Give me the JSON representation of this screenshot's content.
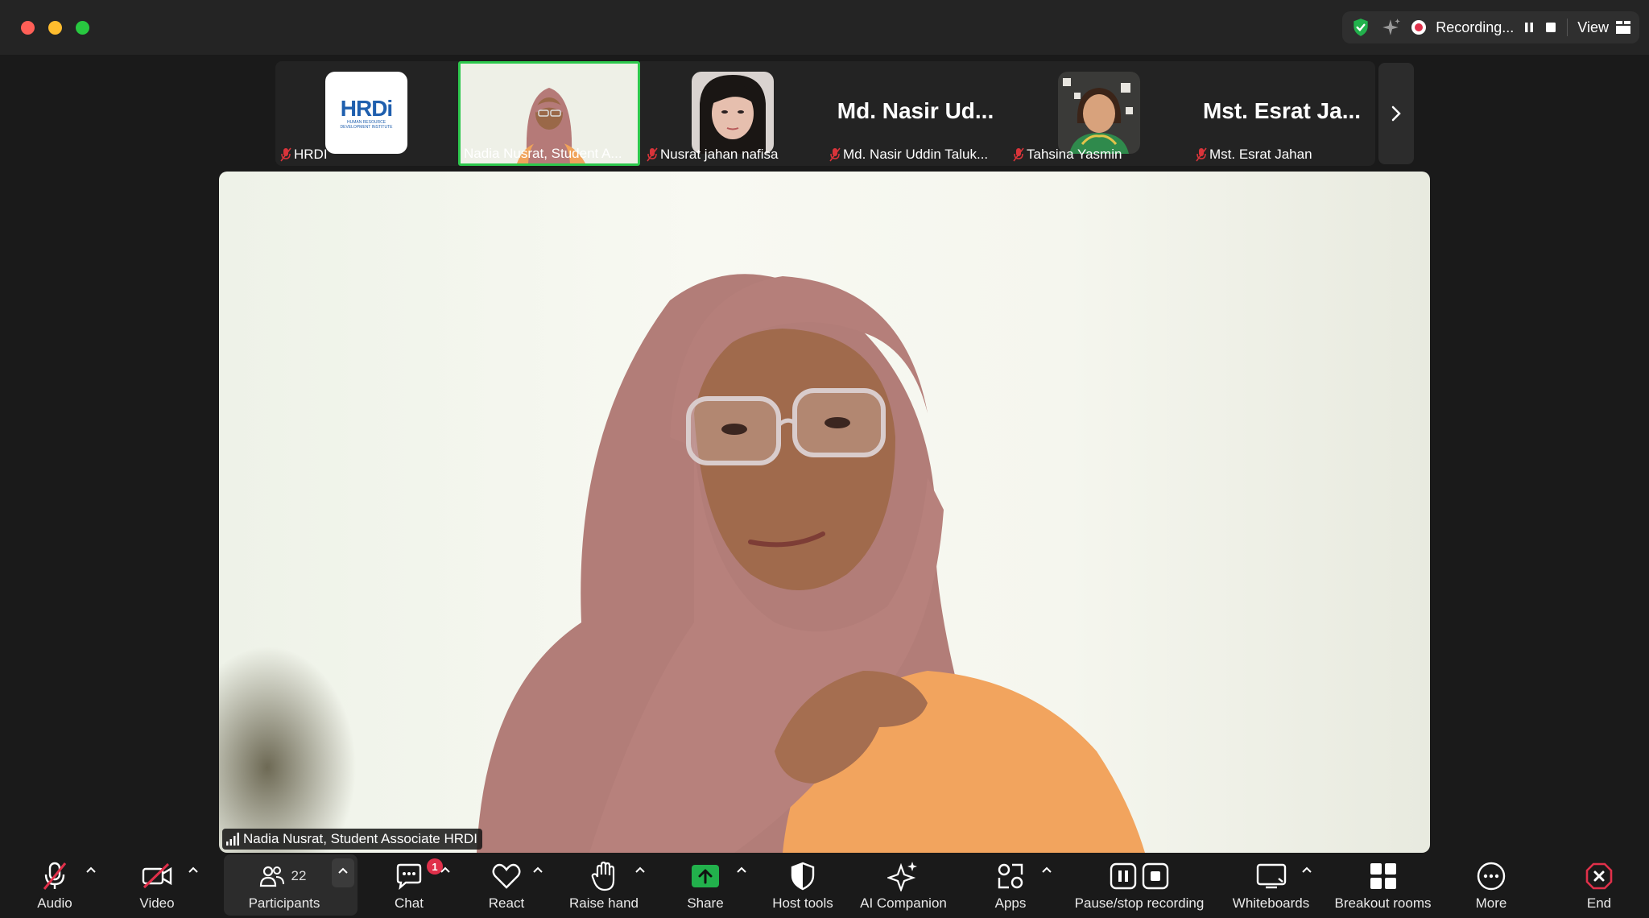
{
  "recording": {
    "status": "Recording...",
    "view_label": "View"
  },
  "participants_strip": [
    {
      "name": "HRDI",
      "type": "logo",
      "logo_text": "HRDi",
      "logo_sub": "HUMAN RESOURCE DEVELOPMENT INSTITUTE"
    },
    {
      "name": "Nadia Nusrat, Student A...",
      "type": "video",
      "active": true
    },
    {
      "name": "Nusrat jahan nafisa",
      "type": "video"
    },
    {
      "name": "Md. Nasir Uddin Taluk...",
      "type": "text",
      "display": "Md. Nasir Ud..."
    },
    {
      "name": "Tahsina Yasmin",
      "type": "video"
    },
    {
      "name": "Mst. Esrat Jahan",
      "type": "text",
      "display": "Mst. Esrat Ja..."
    }
  ],
  "main_speaker": {
    "label": "Nadia Nusrat, Student Associate HRDI"
  },
  "toolbar": {
    "audio": "Audio",
    "video": "Video",
    "participants": "Participants",
    "participants_count": "22",
    "chat": "Chat",
    "chat_badge": "1",
    "react": "React",
    "raise_hand": "Raise hand",
    "share": "Share",
    "host_tools": "Host tools",
    "ai_companion": "AI Companion",
    "apps": "Apps",
    "pause_stop": "Pause/stop recording",
    "whiteboards": "Whiteboards",
    "breakout": "Breakout rooms",
    "more": "More",
    "end": "End"
  },
  "colors": {
    "accent_green": "#2dc84d",
    "record_red": "#e0304a",
    "end_red": "#e0304a",
    "share_green": "#22b14c"
  }
}
